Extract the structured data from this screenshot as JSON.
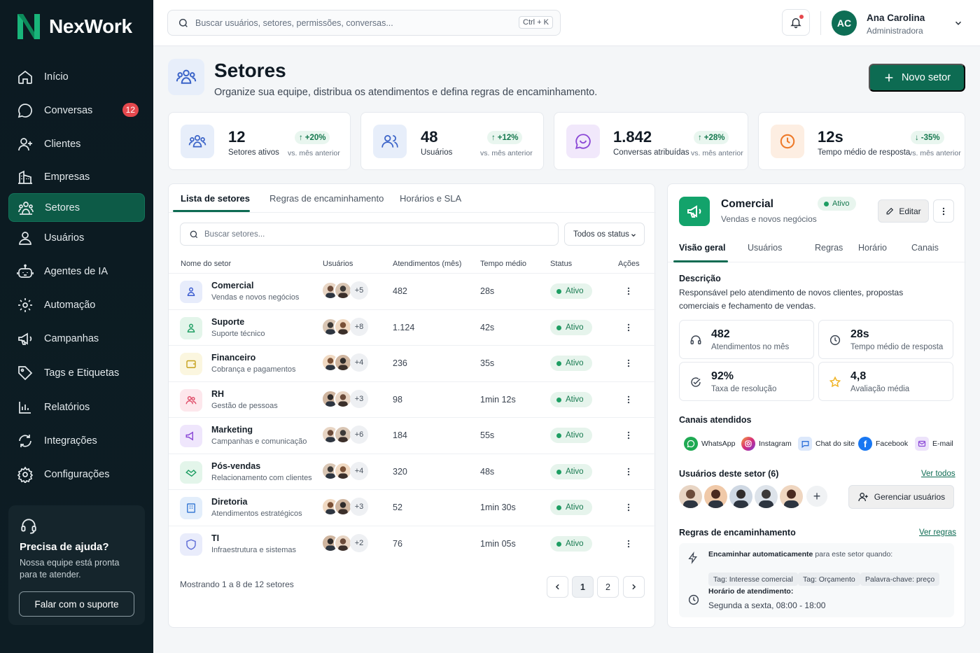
{
  "app": {
    "name": "NexWork"
  },
  "search": {
    "placeholder": "Buscar usuários, setores, permissões, conversas...",
    "shortcut": "Ctrl + K"
  },
  "user": {
    "initials": "AC",
    "name": "Ana Carolina",
    "role": "Administradora"
  },
  "sidebar": {
    "items": [
      {
        "label": "Início",
        "icon": "home-icon"
      },
      {
        "label": "Conversas",
        "icon": "chat-icon",
        "badge": "12"
      },
      {
        "label": "Clientes",
        "icon": "user-plus-icon"
      },
      {
        "label": "Empresas",
        "icon": "building-icon"
      },
      {
        "label": "Setores",
        "icon": "sectors-icon",
        "active": true
      },
      {
        "label": "Usuários",
        "icon": "user-icon"
      },
      {
        "label": "Agentes de IA",
        "icon": "bot-icon"
      },
      {
        "label": "Automação",
        "icon": "automation-icon"
      },
      {
        "label": "Campanhas",
        "icon": "megaphone-icon"
      },
      {
        "label": "Tags e Etiquetas",
        "icon": "tag-icon"
      },
      {
        "label": "Relatórios",
        "icon": "chart-icon"
      },
      {
        "label": "Integrações",
        "icon": "sync-icon"
      },
      {
        "label": "Configurações",
        "icon": "gear-icon"
      }
    ],
    "help": {
      "title": "Precisa de ajuda?",
      "text": "Nossa equipe está pronta para te atender.",
      "button": "Falar com o suporte"
    }
  },
  "header": {
    "title": "Setores",
    "subtitle": "Organize sua equipe, distribua os atendimentos e defina regras de encaminhamento.",
    "new_button": "Novo setor"
  },
  "stats": [
    {
      "value": "12",
      "label": "Setores ativos",
      "delta": "+20%",
      "compare": "vs. mês anterior"
    },
    {
      "value": "48",
      "label": "Usuários",
      "delta": "+12%",
      "compare": "vs. mês anterior"
    },
    {
      "value": "1.842",
      "label": "Conversas atribuídas",
      "delta": "+28%",
      "compare": "vs. mês anterior"
    },
    {
      "value": "12s",
      "label": "Tempo médio de resposta",
      "delta": "-35%",
      "compare": "vs. mês anterior"
    }
  ],
  "list": {
    "tabs": [
      "Lista de setores",
      "Regras de encaminhamento",
      "Horários e SLA"
    ],
    "search_placeholder": "Buscar setores...",
    "status_filter": "Todos os status",
    "columns": [
      "Nome do setor",
      "Usuários",
      "Atendimentos (mês)",
      "Tempo médio",
      "Status",
      "Ações"
    ],
    "rows": [
      {
        "name": "Comercial",
        "desc": "Vendas e novos negócios",
        "more": "+5",
        "count": "482",
        "time": "28s",
        "status": "Ativo"
      },
      {
        "name": "Suporte",
        "desc": "Suporte técnico",
        "more": "+8",
        "count": "1.124",
        "time": "42s",
        "status": "Ativo"
      },
      {
        "name": "Financeiro",
        "desc": "Cobrança e pagamentos",
        "more": "+4",
        "count": "236",
        "time": "35s",
        "status": "Ativo"
      },
      {
        "name": "RH",
        "desc": "Gestão de pessoas",
        "more": "+3",
        "count": "98",
        "time": "1min 12s",
        "status": "Ativo"
      },
      {
        "name": "Marketing",
        "desc": "Campanhas e comunicação",
        "more": "+6",
        "count": "184",
        "time": "55s",
        "status": "Ativo"
      },
      {
        "name": "Pós-vendas",
        "desc": "Relacionamento com clientes",
        "more": "+4",
        "count": "320",
        "time": "48s",
        "status": "Ativo"
      },
      {
        "name": "Diretoria",
        "desc": "Atendimentos estratégicos",
        "more": "+3",
        "count": "52",
        "time": "1min 30s",
        "status": "Ativo"
      },
      {
        "name": "TI",
        "desc": "Infraestrutura e sistemas",
        "more": "+2",
        "count": "76",
        "time": "1min 05s",
        "status": "Ativo"
      }
    ],
    "footer": "Mostrando 1 a 8 de 12 setores",
    "pages": [
      "1",
      "2"
    ]
  },
  "detail": {
    "title": "Comercial",
    "subtitle": "Vendas e novos negócios",
    "status": "Ativo",
    "edit": "Editar",
    "tabs": [
      "Visão geral",
      "Usuários",
      "Regras",
      "Horário",
      "Canais"
    ],
    "desc_title": "Descrição",
    "desc_text": "Responsável pelo atendimento de novos clientes, propostas comerciais e fechamento de vendas.",
    "metrics": [
      {
        "value": "482",
        "label": "Atendimentos no mês"
      },
      {
        "value": "28s",
        "label": "Tempo médio de resposta"
      },
      {
        "value": "92%",
        "label": "Taxa de resolução"
      },
      {
        "value": "4,8",
        "label": "Avaliação média"
      }
    ],
    "channels_title": "Canais atendidos",
    "channels": [
      "WhatsApp",
      "Instagram",
      "Chat do site",
      "Facebook",
      "E-mail"
    ],
    "users_title": "Usuários deste setor (6)",
    "see_all": "Ver todos",
    "manage": "Gerenciar usuários",
    "rules_title": "Regras de encaminhamento",
    "see_rules": "Ver regras",
    "rule_bold": "Encaminhar automaticamente",
    "rule_rest": "para este setor quando:",
    "tags": [
      "Tag: Interesse comercial",
      "Tag: Orçamento",
      "Palavra-chave: preço"
    ],
    "hours_title": "Horário de atendimento:",
    "hours": "Segunda a sexta, 08:00 - 18:00"
  }
}
